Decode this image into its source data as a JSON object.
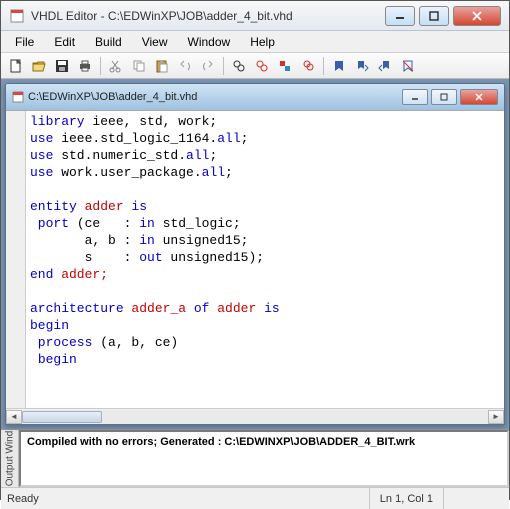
{
  "app": {
    "title": "VHDL Editor - C:\\EDWinXP\\JOB\\adder_4_bit.vhd"
  },
  "menu": {
    "file": "File",
    "edit": "Edit",
    "build": "Build",
    "view": "View",
    "window": "Window",
    "help": "Help"
  },
  "child": {
    "title": "C:\\EDWinXP\\JOB\\adder_4_bit.vhd"
  },
  "code": {
    "l1a": "library",
    "l1b": " ieee, std, work;",
    "l2a": "use",
    "l2b": " ieee.std_logic_1164.",
    "l2c": "all",
    "l2d": ";",
    "l3a": "use",
    "l3b": " std.numeric_std.",
    "l3c": "all",
    "l3d": ";",
    "l4a": "use",
    "l4b": " work.user_package.",
    "l4c": "all",
    "l4d": ";",
    "l5": "",
    "l6a": "entity",
    "l6b": " adder ",
    "l6c": "is",
    "l7a": " port",
    "l7b": " (ce   : ",
    "l7c": "in",
    "l7d": " std_logic;",
    "l8a": "       a, b : ",
    "l8b": "in",
    "l8c": " unsigned15;",
    "l9a": "       s    : ",
    "l9b": "out",
    "l9c": " unsigned15);",
    "l10a": "end",
    "l10b": " adder;",
    "l11": "",
    "l12a": "architecture",
    "l12b": " adder_a ",
    "l12c": "of",
    "l12d": " adder ",
    "l12e": "is",
    "l13": "begin",
    "l14a": " process",
    "l14b": " (a, b, ce)",
    "l15a": " ",
    "l15b": "begin"
  },
  "output": {
    "tab": "Output Wind",
    "line1": "Compiled with no errors; Generated : C:\\EDWINXP\\JOB\\ADDER_4_BIT.wrk"
  },
  "status": {
    "ready": "Ready",
    "pos": "Ln 1, Col 1"
  }
}
